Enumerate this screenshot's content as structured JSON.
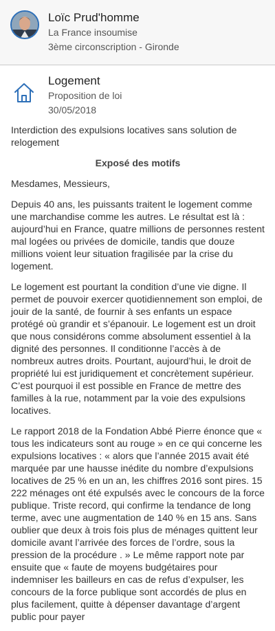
{
  "deputy": {
    "name": "Loïc Prud'homme",
    "party": "La France insoumise",
    "constituency": "3ème circonscription - Gironde",
    "avatar_icon": "person-photo"
  },
  "law": {
    "icon": "house-icon",
    "title": "Logement",
    "type": "Proposition de loi",
    "date": "30/05/2018",
    "subject": "Interdiction des expulsions locatives sans solution de relogement"
  },
  "body": {
    "motifs_title": "Exposé des motifs",
    "salutation": "Mesdames, Messieurs,",
    "paragraphs": [
      "Depuis 40 ans, les puissants traitent le logement comme une marchandise comme les autres. Le résultat est là : aujourd’hui en France, quatre millions de personnes restent mal logées ou privées de domicile, tandis que douze millions voient leur situation fragilisée par la crise du logement.",
      "Le logement est pourtant la condition d’une vie digne. Il permet de pouvoir exercer quotidiennement son emploi, de jouir de la santé, de fournir à ses enfants un espace protégé où grandir et s’épanouir. Le logement est un droit que nous considérons comme absolument essentiel à la dignité des personnes. Il conditionne l’accès à de nombreux autres droits. Pourtant, aujourd’hui, le droit de propriété lui est juridiquement et concrètement supérieur. C’est pourquoi il est possible en France de mettre des familles à la rue, notamment par la voie des expulsions locatives.",
      "Le rapport 2018 de la Fondation Abbé Pierre énonce que « tous les indicateurs sont au rouge » en ce qui concerne les expulsions locatives : « alors que l’année 2015 avait été marquée par une hausse inédite du nombre d’expulsions locatives de 25 % en un an, les chiffres 2016 sont pires. 15 222 ménages ont été expulsés avec le concours de la force publique. Triste record, qui confirme la tendance de long terme, avec une augmentation de 140 % en 15 ans. Sans oublier que deux à trois fois plus de ménages quittent leur domicile avant l’arrivée des forces de l’ordre, sous la pression de la procédure . » Le même rapport note par ensuite que « faute de moyens budgétaires pour indemniser les bailleurs en cas de refus d’expulser, les concours de la force publique sont accordés de plus en plus facilement, quitte à dépenser davantage d’argent public pour payer"
    ]
  },
  "colors": {
    "header_bg": "#f7f7f7",
    "avatar_border": "#2d6fb8",
    "icon_blue": "#2d6fb8"
  }
}
